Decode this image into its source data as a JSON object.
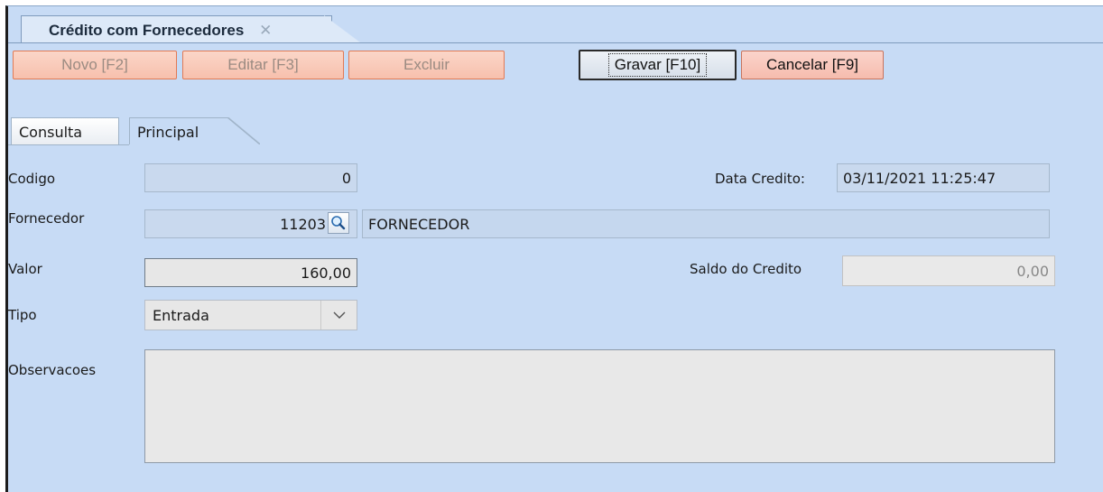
{
  "window": {
    "tab_title": "Crédito com Fornecedores",
    "close_glyph": "✕"
  },
  "toolbar": {
    "novo": "Novo [F2]",
    "editar": "Editar [F3]",
    "excluir": "Excluir",
    "gravar": "Gravar [F10]",
    "cancelar": "Cancelar [F9]"
  },
  "tabs": {
    "consulta": "Consulta",
    "principal": "Principal"
  },
  "form": {
    "codigo_label": "Codigo",
    "codigo_value": "0",
    "data_credito_label": "Data Credito:",
    "data_credito_value": "03/11/2021 11:25:47",
    "fornecedor_label": "Fornecedor",
    "fornecedor_code": "11203",
    "fornecedor_name": "FORNECEDOR",
    "valor_label": "Valor",
    "valor_value": "160,00",
    "saldo_label": "Saldo do Credito",
    "saldo_value": "0,00",
    "tipo_label": "Tipo",
    "tipo_value": "Entrada",
    "observacoes_label": "Observacoes",
    "observacoes_value": ""
  },
  "icons": {
    "lookup": "search-icon",
    "dropdown": "chevron-down-icon",
    "close": "close-icon"
  },
  "colors": {
    "background": "#c7dbf5",
    "disabled_button": "#f7c0ad",
    "cancel_button": "#f6bcae"
  }
}
